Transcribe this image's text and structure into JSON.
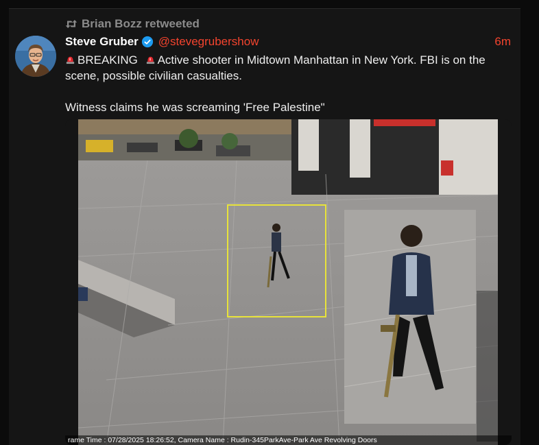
{
  "retweet": {
    "text": "Brian Bozz retweeted",
    "icon": "retweet-icon"
  },
  "author": {
    "name": "Steve Gruber",
    "handle": "@stevegrubershow",
    "verified": true,
    "time": "6m"
  },
  "post": {
    "line1_tag": "BREAKING",
    "line1_text": "Active shooter in Midtown Manhattan in New York. FBI is on the scene, possible civilian  casualties.",
    "line2": "Witness claims he was screaming 'Free Palestine\""
  },
  "media": {
    "caption": "rame Time : 07/28/2025 18:26:52, Camera Name : Rudin-345ParkAve-Park Ave Revolving Doors"
  },
  "colors": {
    "accent": "#f4442e",
    "background": "#0b0b0b",
    "card": "#151515",
    "verified": "#1d9bf0",
    "highlight_box": "#e8e33a"
  }
}
